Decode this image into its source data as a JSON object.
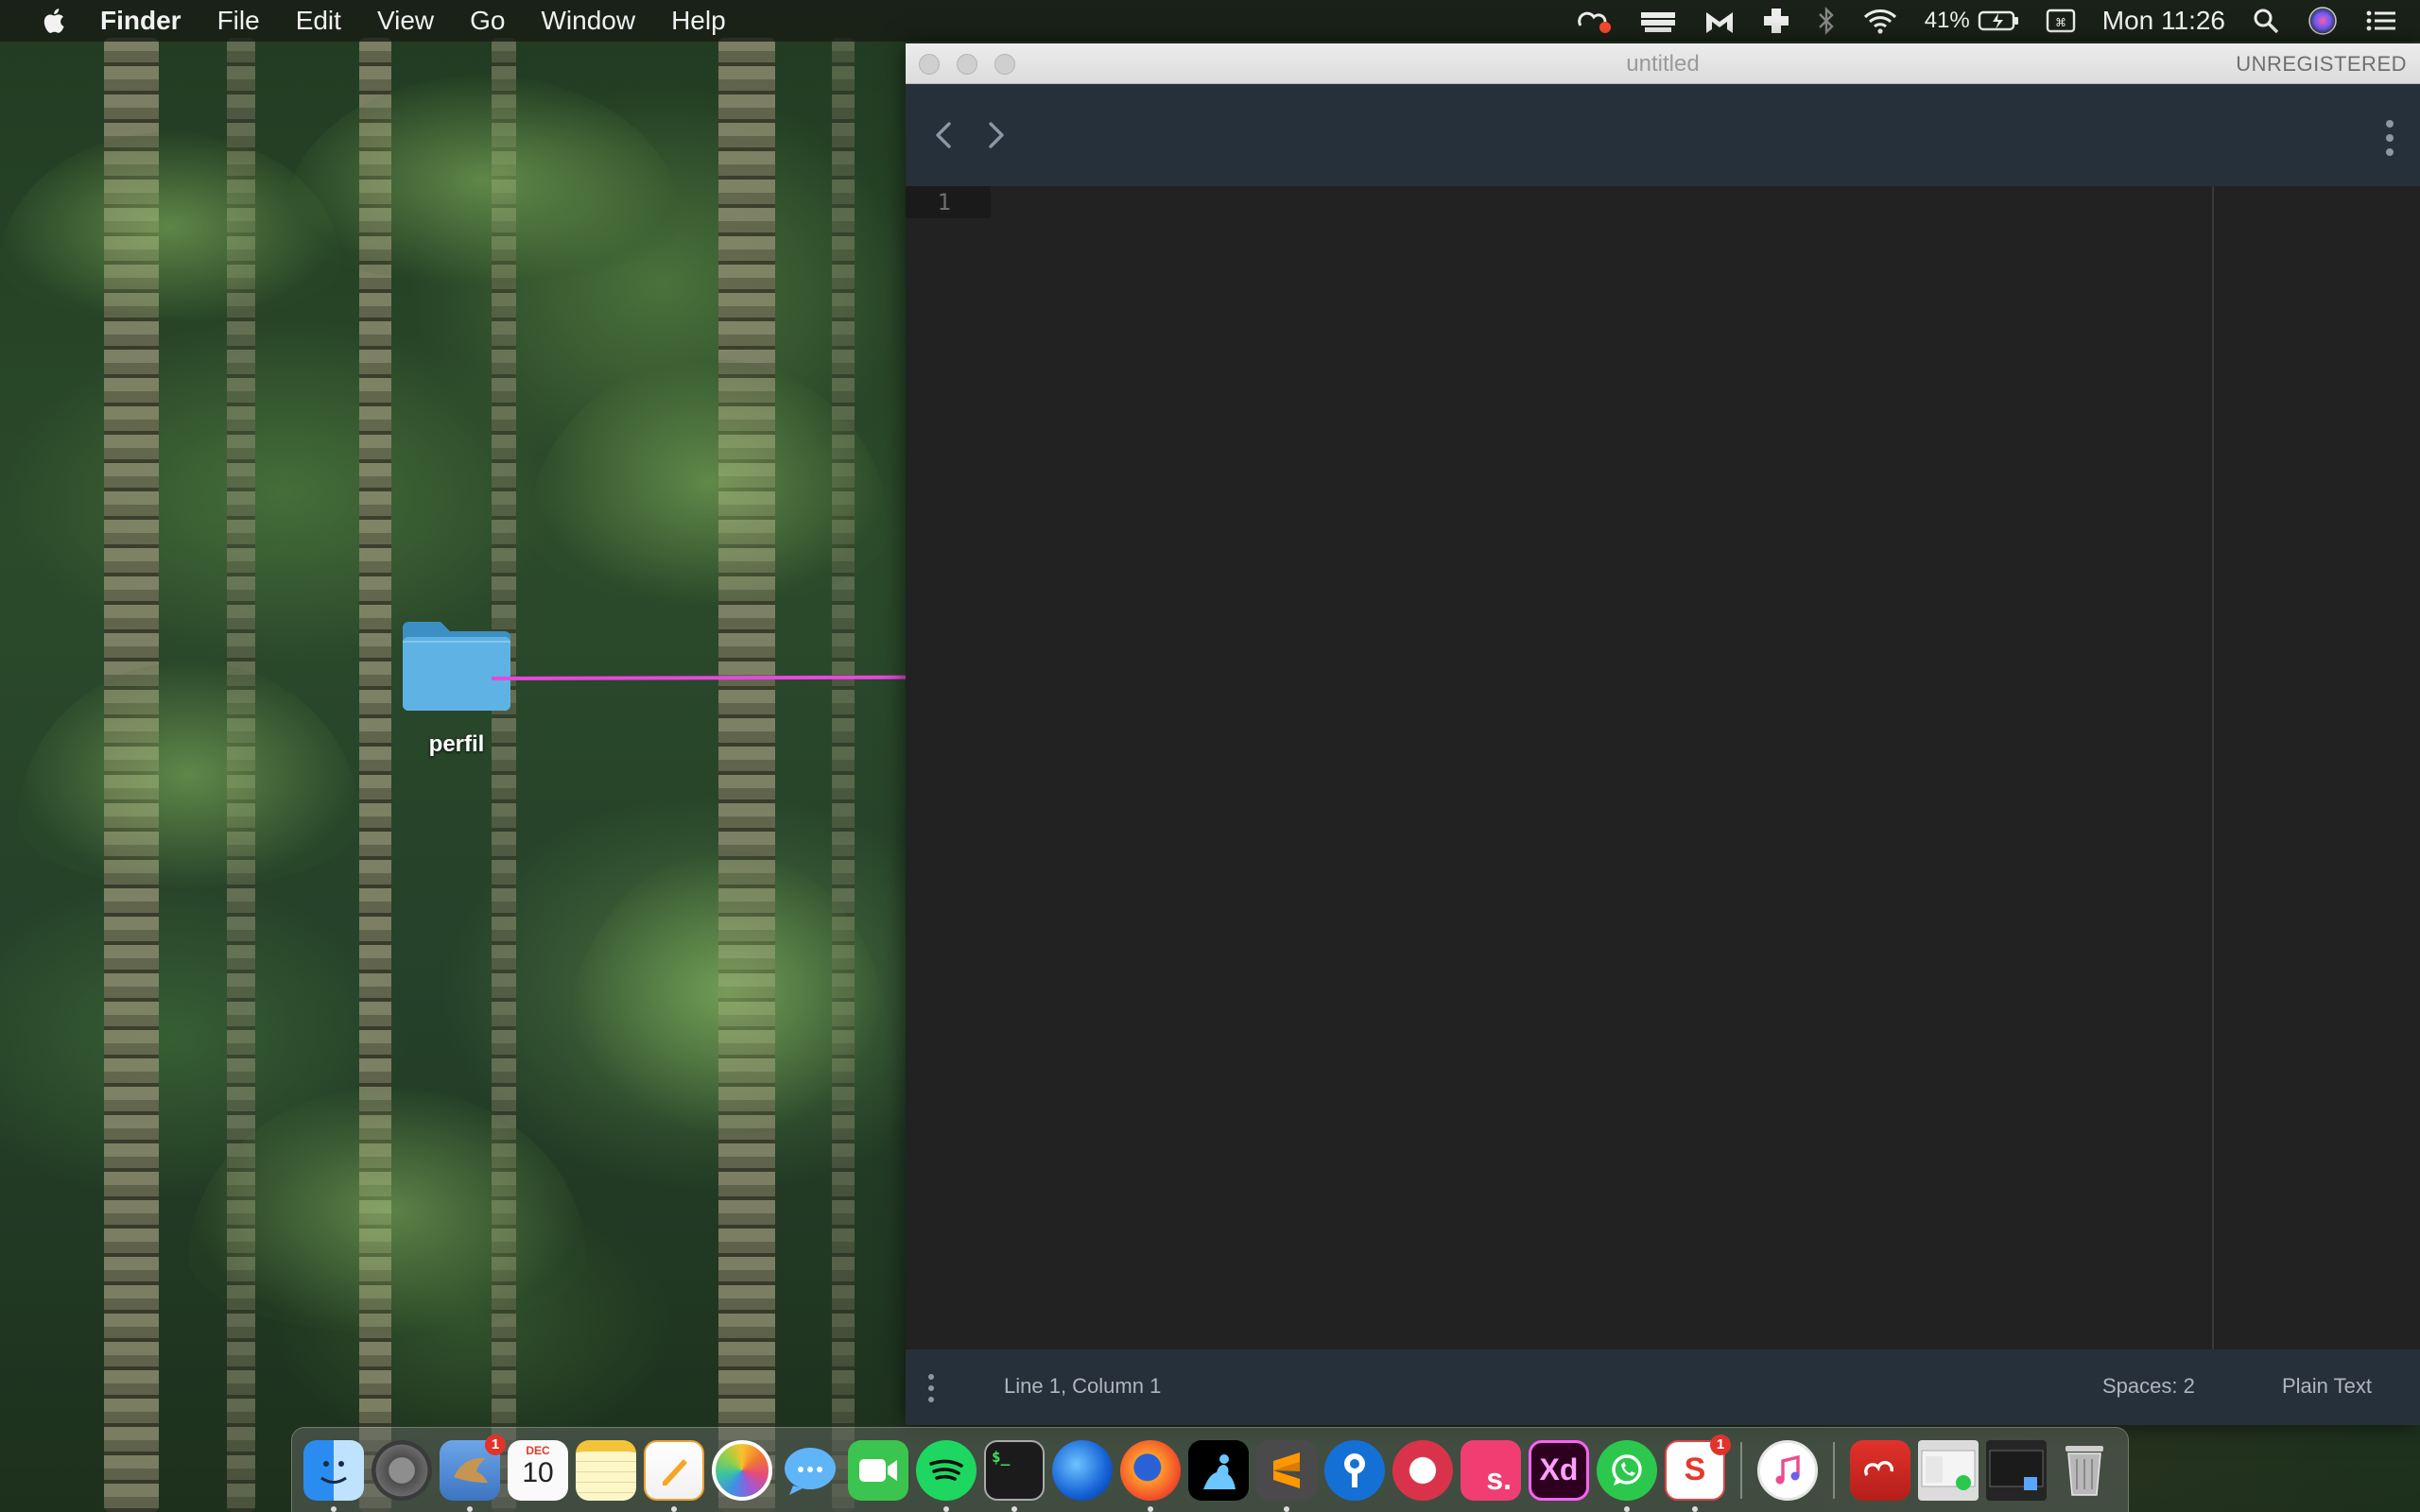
{
  "menubar": {
    "app_name": "Finder",
    "items": [
      "File",
      "Edit",
      "View",
      "Go",
      "Window",
      "Help"
    ],
    "battery_percent": "41%",
    "clock": "Mon 11:26"
  },
  "desktop": {
    "folder_label": "perfil"
  },
  "editor": {
    "window_title": "untitled",
    "license_status": "UNREGISTERED",
    "line_number": "1",
    "status": {
      "position": "Line 1, Column 1",
      "indentation": "Spaces: 2",
      "syntax": "Plain Text"
    }
  },
  "dock": {
    "apps": [
      {
        "name": "finder-icon",
        "running": true
      },
      {
        "name": "system-preferences-icon",
        "running": false
      },
      {
        "name": "mail-bird-icon",
        "running": true,
        "badge": "1"
      },
      {
        "name": "calendar-icon",
        "running": false,
        "month": "DEC",
        "day": "10"
      },
      {
        "name": "notes-icon",
        "running": false
      },
      {
        "name": "pages-icon",
        "running": true
      },
      {
        "name": "photos-icon",
        "running": false
      },
      {
        "name": "messages-icon",
        "running": false
      },
      {
        "name": "facetime-icon",
        "running": false
      },
      {
        "name": "spotify-icon",
        "running": true
      },
      {
        "name": "terminal-icon",
        "running": true
      },
      {
        "name": "firefox-developer-icon",
        "running": false
      },
      {
        "name": "firefox-icon",
        "running": true
      },
      {
        "name": "kindle-icon",
        "running": false
      },
      {
        "name": "sublime-text-icon",
        "running": true
      },
      {
        "name": "sourcetree-icon",
        "running": false
      },
      {
        "name": "taskheat-icon",
        "running": false
      },
      {
        "name": "scribd-icon",
        "running": false
      },
      {
        "name": "adobe-xd-icon",
        "running": false,
        "label": "Xd"
      },
      {
        "name": "whatsapp-icon",
        "running": true
      },
      {
        "name": "slides-icon",
        "running": true,
        "badge": "1"
      },
      {
        "name": "itunes-icon",
        "running": false
      },
      {
        "name": "creative-cloud-folder-icon",
        "running": false
      },
      {
        "name": "whatsapp-window-icon",
        "running": false
      },
      {
        "name": "terminal-window-icon",
        "running": false
      },
      {
        "name": "trash-icon",
        "running": false
      }
    ]
  }
}
